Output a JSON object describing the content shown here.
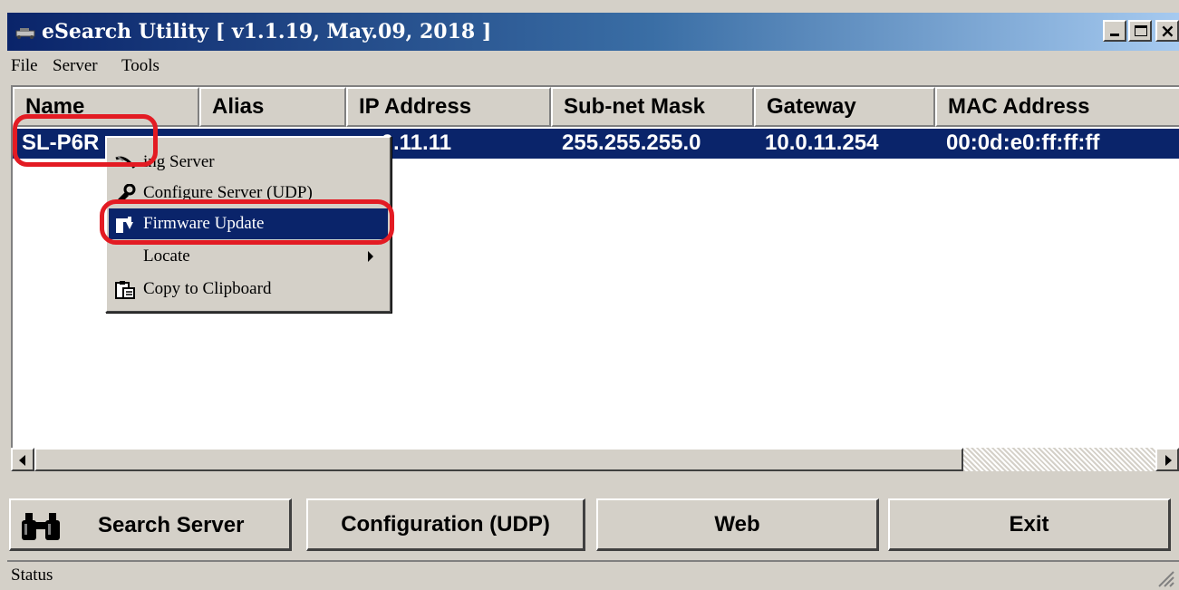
{
  "window": {
    "title": "eSearch Utility [ v1.1.19, May.09, 2018 ]"
  },
  "menu": {
    "items": [
      "File",
      "Server",
      "Tools"
    ]
  },
  "list": {
    "columns": [
      "Name",
      "Alias",
      "IP Address",
      "Sub-net Mask",
      "Gateway",
      "MAC Address"
    ],
    "rows": [
      {
        "name": "SL-P6R",
        "alias": "",
        "ip": ".0.11.11",
        "mask": "255.255.255.0",
        "gateway": "10.0.11.254",
        "mac": "00:0d:e0:ff:ff:ff"
      }
    ],
    "selected_row": 0
  },
  "context_menu": {
    "items": [
      {
        "label": "ing Server",
        "icon": "ping-icon"
      },
      {
        "label": "Configure Server (UDP)",
        "icon": "configure-icon"
      },
      {
        "label": "Firmware Update",
        "icon": "firmware-icon",
        "highlighted": true
      },
      {
        "label": "Locate",
        "icon": "",
        "submenu": true
      },
      {
        "label": "Copy to Clipboard",
        "icon": "clipboard-icon"
      }
    ]
  },
  "buttons": {
    "search": "Search Server",
    "config": "Configuration (UDP)",
    "web": "Web",
    "exit": "Exit"
  },
  "status": {
    "text": "Status"
  },
  "colors": {
    "selection": "#0a246a",
    "face": "#d4d0c8",
    "annotation": "#e31b23"
  }
}
